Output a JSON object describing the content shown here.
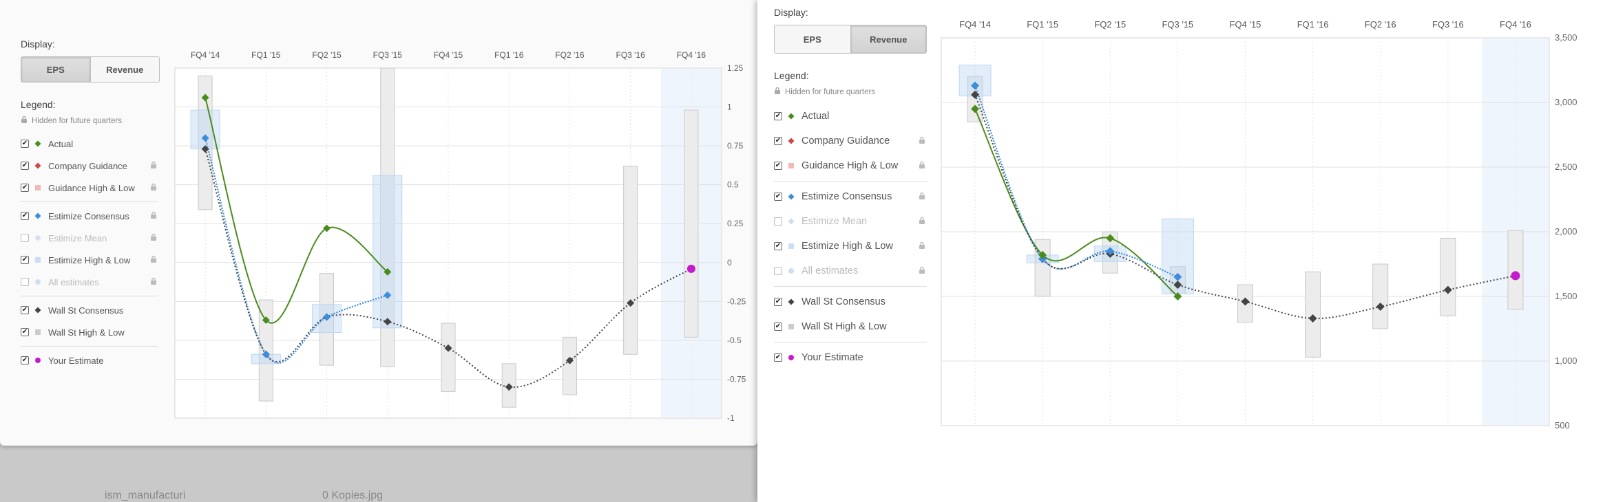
{
  "display": {
    "title": "Display:",
    "eps_label": "EPS",
    "revenue_label": "Revenue"
  },
  "legend": {
    "title": "Legend:",
    "hidden_note": "Hidden for future quarters",
    "items": [
      {
        "label": "Actual",
        "checked": true,
        "marker": "diamond",
        "color": "#4a8c1c",
        "locked": false,
        "dim": false,
        "group": 1
      },
      {
        "label": "Company Guidance",
        "checked": true,
        "marker": "diamond",
        "color": "#d04545",
        "locked": true,
        "dim": false,
        "group": 1
      },
      {
        "label": "Guidance High & Low",
        "checked": true,
        "marker": "square",
        "color": "#f2b8b8",
        "locked": true,
        "dim": false,
        "group": 1
      },
      {
        "label": "Estimize Consensus",
        "checked": true,
        "marker": "diamond",
        "color": "#3c8ddb",
        "locked": true,
        "dim": false,
        "group": 2
      },
      {
        "label": "Estimize Mean",
        "checked": false,
        "marker": "diamond",
        "color": "#9cc7ee",
        "locked": true,
        "dim": true,
        "group": 2
      },
      {
        "label": "Estimize High & Low",
        "checked": true,
        "marker": "square",
        "color": "#c9dff5",
        "locked": true,
        "dim": false,
        "group": 2
      },
      {
        "label": "All estimates",
        "checked": false,
        "marker": "circle",
        "color": "#e0e0e0",
        "locked": true,
        "dim": true,
        "group": 2
      },
      {
        "label": "Wall St Consensus",
        "checked": true,
        "marker": "diamond",
        "color": "#444444",
        "locked": false,
        "dim": false,
        "group": 3
      },
      {
        "label": "Wall St High & Low",
        "checked": true,
        "marker": "square",
        "color": "#cccccc",
        "locked": false,
        "dim": false,
        "group": 3
      },
      {
        "label": "Your Estimate",
        "checked": true,
        "marker": "circle",
        "color": "#c41bd0",
        "locked": false,
        "dim": false,
        "group": 4
      }
    ]
  },
  "desktop_labels": [
    "ism_manufacturi",
    "0 Kopies.jpg"
  ],
  "chart_data": [
    {
      "type": "line",
      "metric": "EPS",
      "categories": [
        "FQ4 '14",
        "FQ1 '15",
        "FQ2 '15",
        "FQ3 '15",
        "FQ4 '15",
        "FQ1 '16",
        "FQ2 '16",
        "FQ3 '16",
        "FQ4 '16"
      ],
      "ylim": [
        -1,
        1.25
      ],
      "yticks": [
        -1,
        -0.75,
        -0.5,
        -0.25,
        0,
        0.25,
        0.5,
        0.75,
        1,
        1.25
      ],
      "ytick_labels": [
        "-1",
        "-0.75",
        "-0.5",
        "-0.25",
        "0",
        "0.25",
        "0.5",
        "0.75",
        "1",
        "1.25"
      ],
      "series": [
        {
          "name": "Actual",
          "color": "#4a8c1c",
          "values": [
            1.06,
            -0.37,
            0.22,
            -0.06,
            null,
            null,
            null,
            null,
            null
          ]
        },
        {
          "name": "Estimize Consensus",
          "color": "#3c8ddb",
          "values": [
            0.8,
            -0.59,
            -0.35,
            -0.21,
            null,
            null,
            null,
            null,
            null
          ]
        },
        {
          "name": "Wall St Consensus",
          "color": "#444444",
          "values": [
            0.73,
            -0.59,
            -0.35,
            -0.38,
            -0.55,
            -0.8,
            -0.63,
            -0.26,
            null
          ]
        },
        {
          "name": "Your Estimate",
          "color": "#c41bd0",
          "values": [
            null,
            null,
            null,
            null,
            null,
            null,
            null,
            null,
            -0.04
          ]
        }
      ],
      "estimize_high_low": [
        [
          0.73,
          0.98
        ],
        [
          -0.65,
          -0.59
        ],
        [
          -0.45,
          -0.27
        ],
        [
          -0.42,
          0.56
        ],
        null,
        null,
        null,
        null,
        null
      ],
      "wallst_high_low": [
        [
          0.34,
          1.2
        ],
        [
          -0.89,
          -0.24
        ],
        [
          -0.66,
          -0.07
        ],
        [
          -0.67,
          null
        ],
        [
          -0.83,
          -0.39
        ],
        [
          -0.93,
          -0.65
        ],
        [
          -0.85,
          -0.48
        ],
        [
          -0.59,
          0.62
        ],
        [
          -0.48,
          0.98
        ]
      ],
      "future_start_index": 8
    },
    {
      "type": "line",
      "metric": "Revenue",
      "categories": [
        "FQ4 '14",
        "FQ1 '15",
        "FQ2 '15",
        "FQ3 '15",
        "FQ4 '15",
        "FQ1 '16",
        "FQ2 '16",
        "FQ3 '16",
        "FQ4 '16"
      ],
      "ylim": [
        500,
        3500
      ],
      "yticks": [
        500,
        1000,
        1500,
        2000,
        2500,
        3000,
        3500
      ],
      "ytick_labels": [
        "500",
        "1,000",
        "1,500",
        "2,000",
        "2,500",
        "3,000",
        "3,500"
      ],
      "series": [
        {
          "name": "Actual",
          "color": "#4a8c1c",
          "values": [
            2950,
            1820,
            1950,
            1500,
            null,
            null,
            null,
            null,
            null
          ]
        },
        {
          "name": "Estimize Consensus",
          "color": "#3c8ddb",
          "values": [
            3130,
            1790,
            1850,
            1650,
            null,
            null,
            null,
            null,
            null
          ]
        },
        {
          "name": "Wall St Consensus",
          "color": "#444444",
          "values": [
            3060,
            1790,
            1830,
            1590,
            1460,
            1330,
            1420,
            1550,
            null
          ]
        },
        {
          "name": "Your Estimate",
          "color": "#c41bd0",
          "values": [
            null,
            null,
            null,
            null,
            null,
            null,
            null,
            null,
            1660
          ]
        }
      ],
      "estimize_high_low": [
        [
          3050,
          3290
        ],
        [
          1760,
          1820
        ],
        [
          1770,
          1890
        ],
        [
          1520,
          2100
        ],
        null,
        null,
        null,
        null,
        null
      ],
      "wallst_high_low": [
        [
          2850,
          3200
        ],
        [
          1500,
          1940
        ],
        [
          1680,
          2000
        ],
        [
          1520,
          1730
        ],
        [
          1300,
          1590
        ],
        [
          1030,
          1690
        ],
        [
          1250,
          1750
        ],
        [
          1350,
          1950
        ],
        [
          1400,
          2010
        ]
      ],
      "future_start_index": 8
    }
  ]
}
